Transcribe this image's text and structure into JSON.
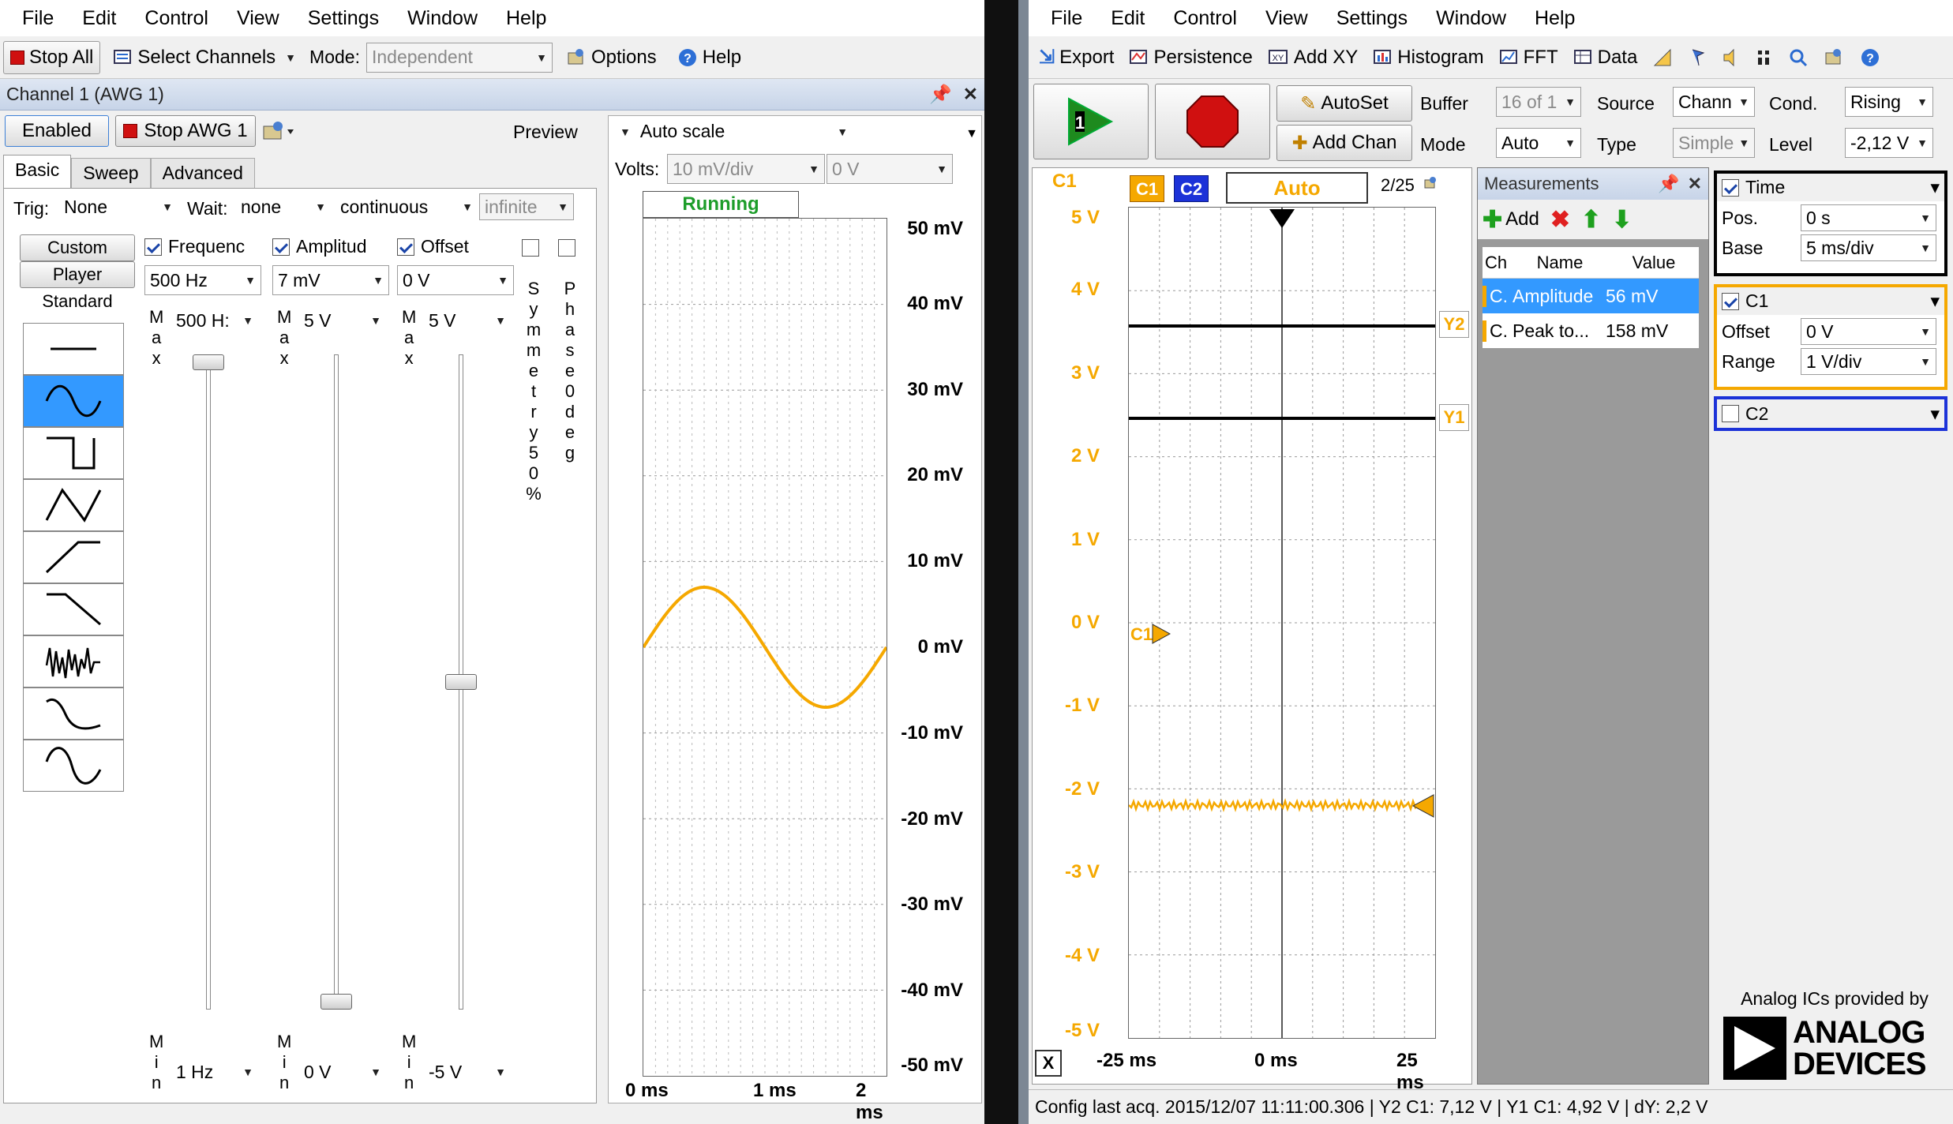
{
  "awg": {
    "menu": [
      "File",
      "Edit",
      "Control",
      "View",
      "Settings",
      "Window",
      "Help"
    ],
    "toolbar": {
      "stop_all": "Stop All",
      "select_channels": "Select Channels",
      "mode_label": "Mode:",
      "mode_value": "Independent",
      "options": "Options",
      "help": "Help"
    },
    "channel_title": "Channel 1 (AWG 1)",
    "enabled": "Enabled",
    "stop_awg": "Stop AWG 1",
    "preview": "Preview",
    "tabs": [
      "Basic",
      "Sweep",
      "Advanced"
    ],
    "trig_label": "Trig:",
    "trig_value": "None",
    "wait_label": "Wait:",
    "wait_value": "none",
    "continuous": "continuous",
    "infinite": "infinite",
    "side_tabs": [
      "Custom",
      "Player",
      "Standard"
    ],
    "frequency": {
      "label": "Frequenc",
      "value": "500 Hz",
      "max": "500 H:",
      "min": "1 Hz",
      "maxlbl": "Max",
      "minlbl": "Min",
      "level": 1.0
    },
    "amplitude": {
      "label": "Amplitud",
      "value": "7 mV",
      "max": "5 V",
      "min": "0 V",
      "level": 0.0
    },
    "offset": {
      "label": "Offset",
      "value": "0 V",
      "max": "5 V",
      "min": "-5 V",
      "level": 0.5
    },
    "symmetry": "Symmetry 50%",
    "phase": "Phase 0deg",
    "autoscale": "Auto scale",
    "volts_label": "Volts:",
    "volts_value": "10 mV/div",
    "volts_offset": "0 V",
    "running": "Running",
    "y_ticks": [
      "50 mV",
      "40 mV",
      "30 mV",
      "20 mV",
      "10 mV",
      "0 mV",
      "-10 mV",
      "-20 mV",
      "-30 mV",
      "-40 mV",
      "-50 mV"
    ],
    "x_ticks": [
      "0 ms",
      "1 ms",
      "2 ms"
    ],
    "wave_color": "#f5a800"
  },
  "scope": {
    "menu": [
      "File",
      "Edit",
      "Control",
      "View",
      "Settings",
      "Window",
      "Help"
    ],
    "toolbar": [
      "Export",
      "Persistence",
      "Add XY",
      "Histogram",
      "FFT",
      "Data"
    ],
    "autoset": "AutoSet",
    "add_chan": "Add Chan",
    "buffer_label": "Buffer",
    "buffer_value": "16 of 1",
    "mode_label": "Mode",
    "mode_value": "Auto",
    "source_label": "Source",
    "source_value": "Chann",
    "type_label": "Type",
    "type_value": "Simple",
    "cond_label": "Cond.",
    "cond_value": "Rising",
    "level_label": "Level",
    "level_value": "-2,12 V",
    "plot": {
      "c1_label": "C1",
      "c1_tab": "C1",
      "c2_tab": "C2",
      "status": "Auto",
      "counter": "2/25",
      "y_ticks": [
        "5 V",
        "4 V",
        "3 V",
        "2 V",
        "1 V",
        "0 V",
        "-1 V",
        "-2 V",
        "-3 V",
        "-4 V",
        "-5 V"
      ],
      "x_ticks": [
        "-25 ms",
        "0 ms",
        "25 ms"
      ],
      "x_button": "X",
      "y2": "Y2",
      "y1": "Y1",
      "c1_marker": "C1",
      "trace_color": "#f5a800"
    },
    "measurements": {
      "title": "Measurements",
      "add": "Add",
      "headers": [
        "Ch",
        "Name",
        "Value"
      ],
      "rows": [
        {
          "ch": "C...",
          "name": "Amplitude",
          "value": "56 mV"
        },
        {
          "ch": "C...",
          "name": "Peak to...",
          "value": "158 mV"
        }
      ]
    },
    "time": {
      "title": "Time",
      "pos_label": "Pos.",
      "pos_value": "0 s",
      "base_label": "Base",
      "base_value": "5 ms/div"
    },
    "c1": {
      "title": "C1",
      "offset_label": "Offset",
      "offset_value": "0 V",
      "range_label": "Range",
      "range_value": "1 V/div"
    },
    "c2": {
      "title": "C2"
    },
    "brand_caption": "Analog ICs provided by",
    "brand_line1": "ANALOG",
    "brand_line2": "DEVICES",
    "status": "Config last acq. 2015/12/07  11:11:00.306  |  Y2 C1: 7,12 V | Y1 C1: 4,92 V | dY: 2,2 V"
  }
}
